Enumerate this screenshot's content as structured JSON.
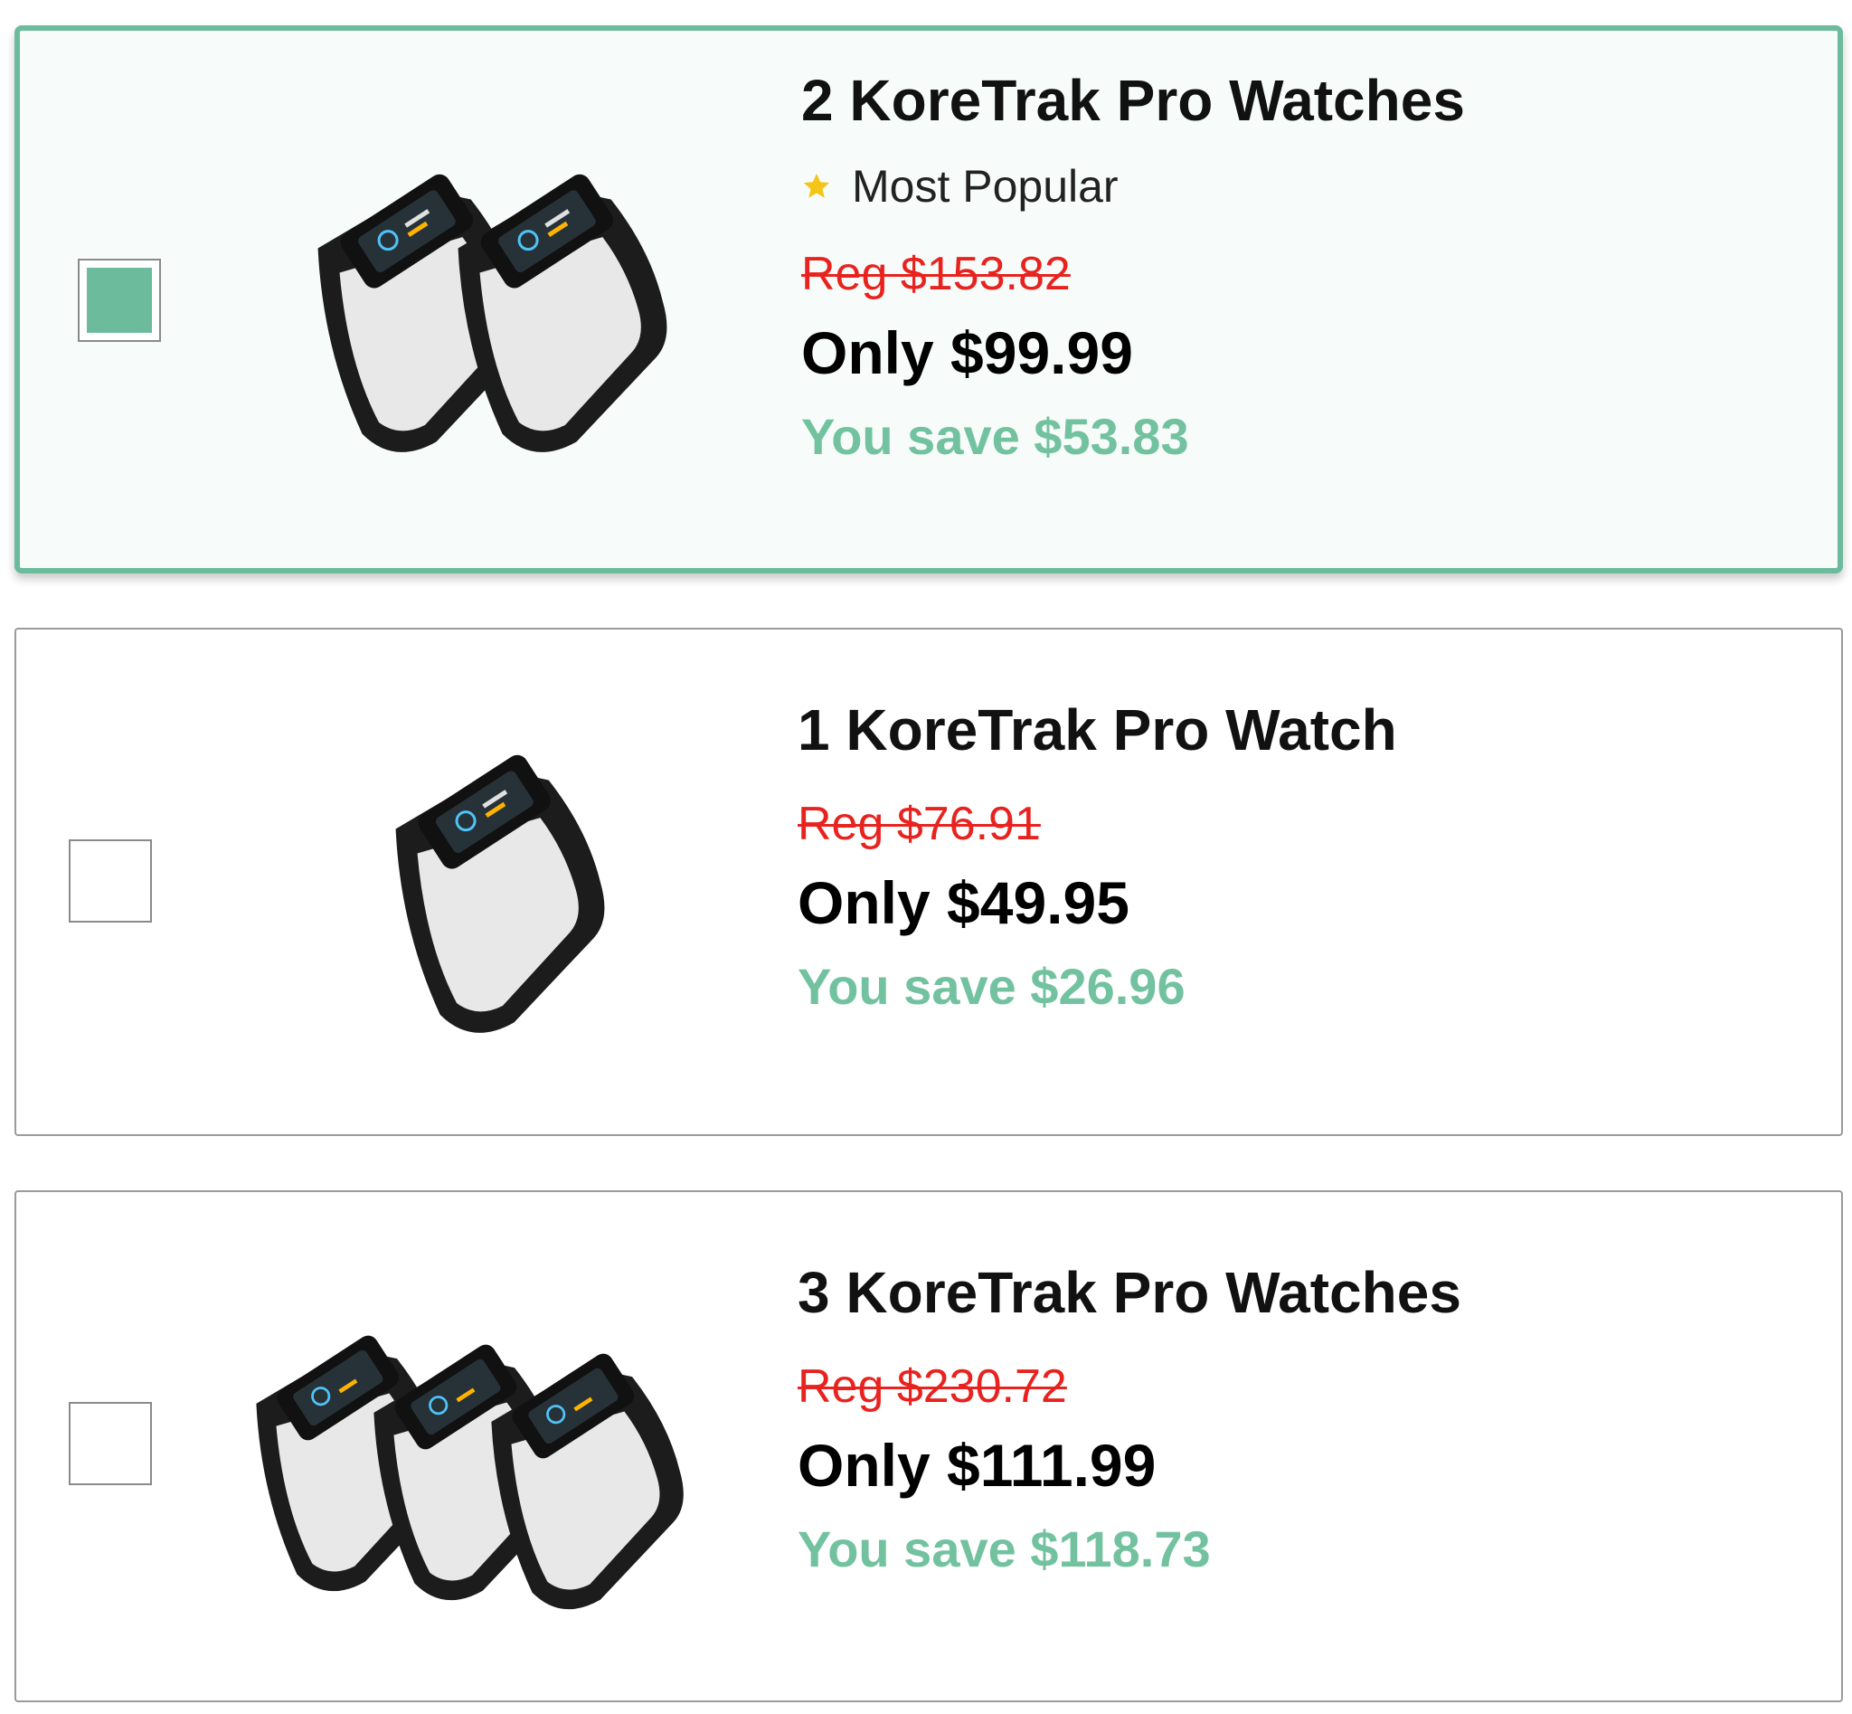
{
  "offers": [
    {
      "title": "2 KoreTrak Pro Watches",
      "badge": "Most Popular",
      "badge_icon": "star-icon",
      "reg_price": "Reg $153.82",
      "price": "Only $99.99",
      "savings": "You save $53.83",
      "selected": true,
      "watch_count": 2
    },
    {
      "title": "1 KoreTrak Pro Watch",
      "reg_price": "Reg $76.91",
      "price": "Only $49.95",
      "savings": "You save $26.96",
      "selected": false,
      "watch_count": 1
    },
    {
      "title": "3 KoreTrak Pro Watches",
      "reg_price": "Reg $230.72",
      "price": "Only $111.99",
      "savings": "You save $118.73",
      "selected": false,
      "watch_count": 3
    }
  ],
  "colors": {
    "accent": "#6cbb9d",
    "savings": "#72c2a0",
    "reg_price": "#e8231f",
    "star": "#f5c518"
  }
}
